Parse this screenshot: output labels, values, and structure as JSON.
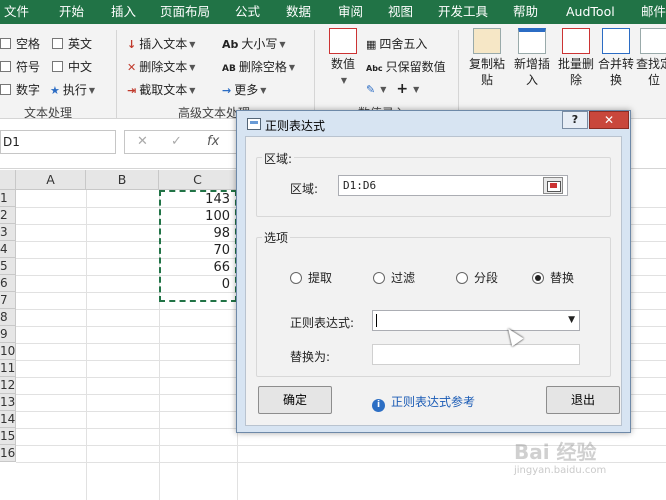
{
  "menu": [
    "文件",
    "开始",
    "插入",
    "页面布局",
    "公式",
    "数据",
    "审阅",
    "视图",
    "开发工具",
    "帮助",
    "AudTool",
    "邮件"
  ],
  "ribbon": {
    "checks": [
      "空格",
      "英文",
      "符号",
      "中文",
      "数字"
    ],
    "execute": "执行",
    "text_ops": [
      "插入文本",
      "删除文本",
      "截取文本"
    ],
    "case_ops": [
      "大小写",
      "删除空格",
      "更多"
    ],
    "numeric": "数值",
    "round": "四舍五入",
    "keep_value": "只保留数值",
    "big_buttons": [
      "复制粘贴",
      "新增插入",
      "批量删除",
      "合并转换",
      "查找定位"
    ],
    "groups": [
      "文本处理",
      "高级文本处理",
      "数值录入"
    ]
  },
  "formula_bar": {
    "name_box": "D1",
    "cancel": "✕",
    "enter": "✓",
    "fx": "fx"
  },
  "grid": {
    "columns": [
      "A",
      "B",
      "C"
    ],
    "rows": [
      "1",
      "2",
      "3",
      "4",
      "5",
      "6",
      "7",
      "8",
      "9",
      "10",
      "11",
      "12",
      "13",
      "14",
      "15",
      "16"
    ],
    "c_values": [
      "143",
      "100",
      "98",
      "70",
      "66",
      "0"
    ]
  },
  "dialog": {
    "title": "正则表达式",
    "help": "?",
    "close": "✕",
    "range_section": "区域:",
    "range_label": "区域:",
    "range_value": "D1:D6",
    "options_section": "选项",
    "options": [
      "提取",
      "过滤",
      "分段",
      "替换"
    ],
    "selected_option": "替换",
    "regex_label": "正则表达式:",
    "replace_label": "替换为:",
    "ok": "确定",
    "ref_link": "正则表达式参考",
    "exit": "退出"
  },
  "watermark": {
    "brand": "Bai 经验",
    "url": "jingyan.baidu.com"
  },
  "colors": {
    "excel_green": "#217346",
    "dialog_frame": "#d7e4f2",
    "close_red": "#c9473c"
  }
}
